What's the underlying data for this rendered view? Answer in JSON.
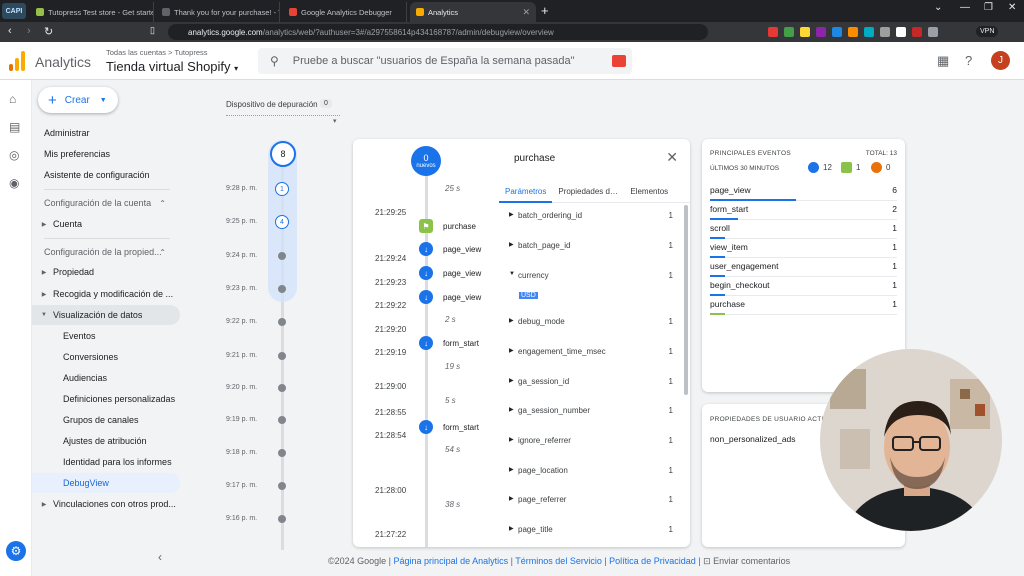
{
  "browser": {
    "app_badge": "CAPI",
    "tabs": [
      {
        "title": "Tutopress Test store - Get started wi"
      },
      {
        "title": "Thank you for your purchase! - Tuto"
      },
      {
        "title": "Google Analytics Debugger"
      },
      {
        "title": "Analytics",
        "active": true
      }
    ],
    "new_tab": "+",
    "url_host": "analytics.google.com",
    "url_path": "/analytics/web/?authuser=3#/a297558614p434168787/admin/debugview/overview",
    "vpn_label": "VPN"
  },
  "header": {
    "product": "Analytics",
    "breadcrumb": "Todas las cuentas > Tutopress",
    "property": "Tienda virtual Shopify",
    "search_placeholder": "Pruebe a buscar \"usuarios de España la semana pasada\"",
    "avatar_initial": "J"
  },
  "nav": {
    "create_label": "Crear",
    "items": {
      "admin": "Administrar",
      "prefs": "Mis preferencias",
      "setup": "Asistente de configuración",
      "account_cfg": "Configuración de la cuenta",
      "account": "Cuenta",
      "property_cfg": "Configuración de la propied...",
      "property": "Propiedad",
      "collection": "Recogida y modificación de ...",
      "data_display": "Visualización de datos",
      "events": "Eventos",
      "conversions": "Conversiones",
      "audiences": "Audiencias",
      "custom_defs": "Definiciones personalizadas",
      "channel_groups": "Grupos de canales",
      "attribution": "Ajustes de atribución",
      "reporting_id": "Identidad para los informes",
      "debugview": "DebugView",
      "links": "Vinculaciones con otros prod..."
    }
  },
  "debug": {
    "device_label": "Dispositivo de depuración",
    "device_count": "0",
    "minutes_top": "8",
    "minutes": [
      {
        "label": "9:28 p. m.",
        "count": "1"
      },
      {
        "label": "9:25 p. m.",
        "count": "4"
      },
      {
        "label": "9:24 p. m."
      },
      {
        "label": "9:23 p. m."
      },
      {
        "label": "9:22 p. m."
      },
      {
        "label": "9:21 p. m."
      },
      {
        "label": "9:20 p. m."
      },
      {
        "label": "9:19 p. m."
      },
      {
        "label": "9:18 p. m."
      },
      {
        "label": "9:17 p. m."
      },
      {
        "label": "9:16 p. m."
      }
    ]
  },
  "stream": {
    "top_count": "0",
    "top_label": "nuevos",
    "times": [
      "21:29:25",
      "21:29:24",
      "21:29:23",
      "21:29:22",
      "21:29:20",
      "21:29:19",
      "21:29:00",
      "21:28:55",
      "21:28:54",
      "21:28:00",
      "21:27:22"
    ],
    "gaps": [
      "25 s",
      "2 s",
      "19 s",
      "5 s",
      "54 s",
      "38 s"
    ],
    "events": [
      "purchase",
      "page_view",
      "page_view",
      "page_view",
      "form_start",
      "form_start"
    ]
  },
  "detail": {
    "title": "purchase",
    "tabs": [
      "Parámetros",
      "Propiedades de ...",
      "Elementos"
    ],
    "params": [
      {
        "name": "batch_ordering_id",
        "count": "1"
      },
      {
        "name": "batch_page_id",
        "count": "1"
      },
      {
        "name": "currency",
        "count": "1",
        "value": "USD"
      },
      {
        "name": "debug_mode",
        "count": "1"
      },
      {
        "name": "engagement_time_msec",
        "count": "1"
      },
      {
        "name": "ga_session_id",
        "count": "1"
      },
      {
        "name": "ga_session_number",
        "count": "1"
      },
      {
        "name": "ignore_referrer",
        "count": "1"
      },
      {
        "name": "page_location",
        "count": "1"
      },
      {
        "name": "page_referrer",
        "count": "1"
      },
      {
        "name": "page_title",
        "count": "1"
      }
    ]
  },
  "top_events": {
    "title": "PRINCIPALES EVENTOS",
    "total": "TOTAL: 13",
    "subtitle": "ÚLTIMOS 30 MINUTOS",
    "badges": [
      {
        "count": "12",
        "color": "#1a73e8"
      },
      {
        "count": "1",
        "color": "#8bc34a"
      },
      {
        "count": "0",
        "color": "#e8710a"
      }
    ],
    "rows": [
      {
        "name": "page_view",
        "count": "6",
        "share": 0.46
      },
      {
        "name": "form_start",
        "count": "2",
        "share": 0.15
      },
      {
        "name": "scroll",
        "count": "1",
        "share": 0.08
      },
      {
        "name": "view_item",
        "count": "1",
        "share": 0.08
      },
      {
        "name": "user_engagement",
        "count": "1",
        "share": 0.08
      },
      {
        "name": "begin_checkout",
        "count": "1",
        "share": 0.08
      },
      {
        "name": "purchase",
        "count": "1",
        "share": 0.08
      }
    ]
  },
  "user_props": {
    "title": "PROPIEDADES DE USUARIO ACTIVAS",
    "row": "non_personalized_ads"
  },
  "footer": {
    "copyright": "©2024 Google |",
    "home": "Página principal de Analytics",
    "terms": "Términos del Servicio",
    "privacy": "Política de Privacidad",
    "feedback": "Enviar comentarios"
  }
}
